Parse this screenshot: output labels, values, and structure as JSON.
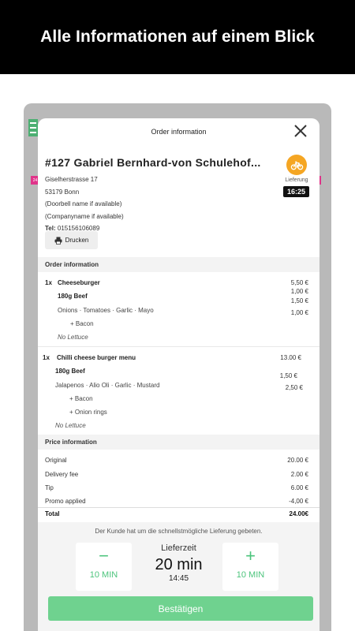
{
  "banner": {
    "headline": "Alle Informationen auf einem Blick"
  },
  "modal": {
    "title": "Order information"
  },
  "customer": {
    "title": "#127 Gabriel Bernhard-von Schulehof...",
    "street": "Giselherstrasse 17",
    "city": "53179 Bonn",
    "doorbell": "(Doorbell name if available)",
    "company": "(Companyname if available)",
    "phone_label": "Tel:",
    "phone": "015156106089",
    "print_label": "Drucken",
    "side_tag": "24"
  },
  "delivery": {
    "label": "Lieferung",
    "time": "16:25",
    "icon": "bicycle-icon",
    "color": "#f5a623"
  },
  "order_section": {
    "heading": "Order information",
    "items": [
      {
        "qty": "1x",
        "name": "Cheeseburger",
        "price": "5,50 €",
        "sub": "180g Beef",
        "sub_price": "1,00 €",
        "sub_price2": "1,50 €",
        "toppings": "Onions · Tomatoes · Garlic · Mayo",
        "toppings_price": "1,00 €",
        "extra": "+ Bacon",
        "note": "No Lettuce"
      },
      {
        "qty": "1x",
        "name": "Chilli cheese burger menu",
        "price": "13.00 €",
        "sub": "180g Beef",
        "sub_price": "1,50 €",
        "toppings": "Jalapenos · Alio Oli · Garlic · Mustard",
        "toppings_price": "2,50 €",
        "extra": "+ Bacon",
        "extra2": "+ Onion rings",
        "note": "No Lettuce"
      }
    ]
  },
  "price_section": {
    "heading": "Price information",
    "rows": [
      {
        "label": "Original",
        "value": "20.00 €"
      },
      {
        "label": "Delivery fee",
        "value": "2.00 €"
      },
      {
        "label": "Tip",
        "value": "6.00 €"
      },
      {
        "label": "Promo applied",
        "value": "-4,00 €"
      }
    ],
    "total": {
      "label": "Total",
      "value": "24.00€"
    }
  },
  "footer": {
    "note": "Der Kunde hat um die schnellstmögliche Lieferung gebeten.",
    "minus": {
      "symbol": "−",
      "label": "10 MIN"
    },
    "plus": {
      "symbol": "+",
      "label": "10 MIN"
    },
    "eta_label": "Lieferzeit",
    "eta_value": "20 min",
    "eta_time": "14:45",
    "confirm_label": "Bestätigen"
  },
  "colors": {
    "accent_green": "#4cc47c",
    "confirm_green": "#6fd28f",
    "tag_pink": "#e0348a"
  }
}
